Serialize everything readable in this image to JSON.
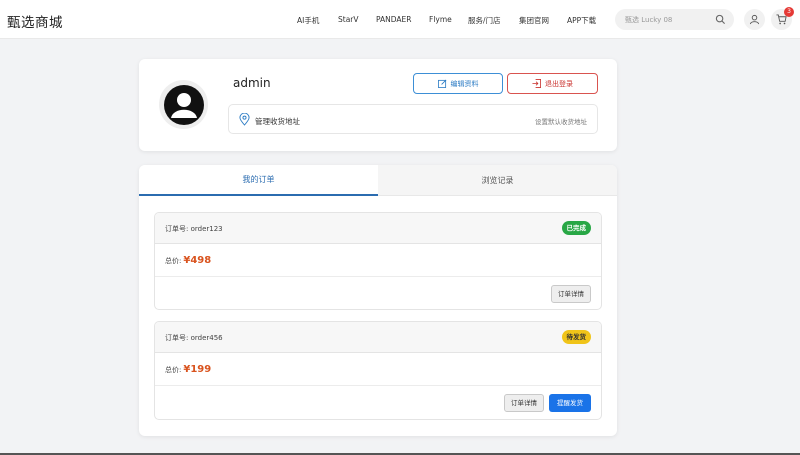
{
  "header": {
    "brand": "甄选商城",
    "nav": [
      "AI手机",
      "StarV",
      "PANDAER",
      "Flyme",
      "服务/门店",
      "集团官网",
      "APP下载"
    ],
    "search_placeholder": "甄选 Lucky 08",
    "cart_count": "3"
  },
  "profile": {
    "username": "admin",
    "edit_label": "编辑资料",
    "logout_label": "退出登录",
    "address_label": "管理收货地址",
    "address_default": "设置默认收货地址"
  },
  "tabs": {
    "orders": "我的订单",
    "history": "浏览记录"
  },
  "orders": [
    {
      "number": "订单号: order123",
      "status": "已完成",
      "total_label": "总价:",
      "price": "¥498",
      "detail_label": "订单详情"
    },
    {
      "number": "订单号: order456",
      "status": "待发货",
      "total_label": "总价:",
      "price": "¥199",
      "detail_label": "订单详情",
      "remind_label": "提醒发货"
    }
  ],
  "colors": {
    "accent": "#2b6cb0",
    "danger": "#d9534f",
    "price": "#d9531e",
    "done": "#28a745",
    "pending": "#f0c419",
    "primary_btn": "#1a73e8"
  }
}
